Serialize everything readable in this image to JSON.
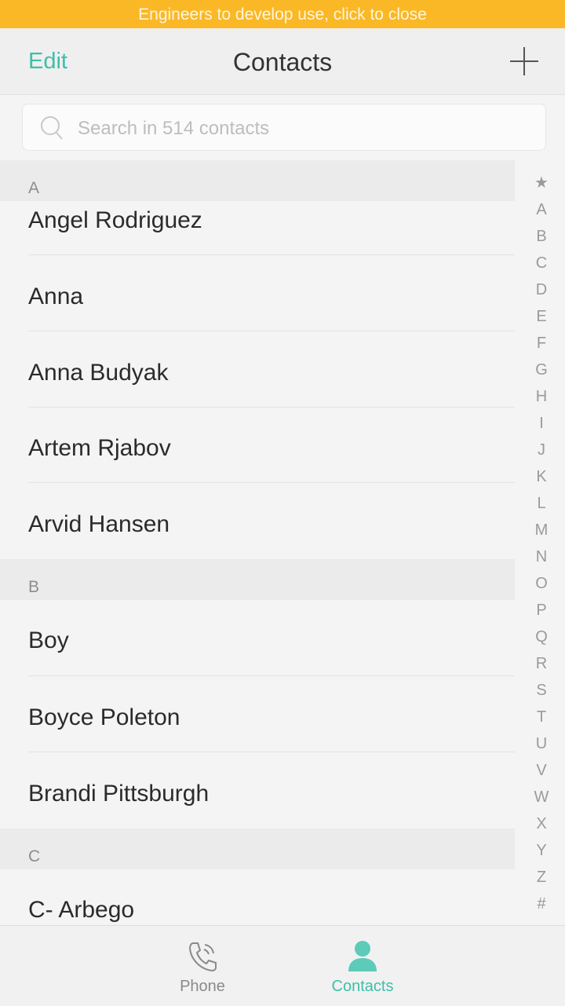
{
  "banner": {
    "text": "Engineers to develop use, click to close"
  },
  "header": {
    "edit_label": "Edit",
    "title": "Contacts",
    "add_icon": "plus-icon"
  },
  "search": {
    "placeholder": "Search in 514 contacts",
    "icon": "search-icon"
  },
  "sections": [
    {
      "letter": "A",
      "contacts": [
        "Angel Rodriguez",
        "Anna",
        "Anna Budyak",
        "Artem Rjabov",
        "Arvid Hansen"
      ]
    },
    {
      "letter": "B",
      "contacts": [
        "Boy",
        "Boyce Poleton",
        "Brandi Pittsburgh"
      ]
    },
    {
      "letter": "C",
      "contacts": [
        "C- Arbego"
      ]
    }
  ],
  "index_letters": [
    "★",
    "A",
    "B",
    "C",
    "D",
    "E",
    "F",
    "G",
    "H",
    "I",
    "J",
    "K",
    "L",
    "M",
    "N",
    "O",
    "P",
    "Q",
    "R",
    "S",
    "T",
    "U",
    "V",
    "W",
    "X",
    "Y",
    "Z",
    "#"
  ],
  "tabs": [
    {
      "label": "Phone",
      "icon": "phone-icon",
      "active": false
    },
    {
      "label": "Contacts",
      "icon": "person-icon",
      "active": true
    }
  ],
  "colors": {
    "accent": "#3dbfaa",
    "banner": "#fbb826",
    "inactive": "#8a8a8a"
  }
}
